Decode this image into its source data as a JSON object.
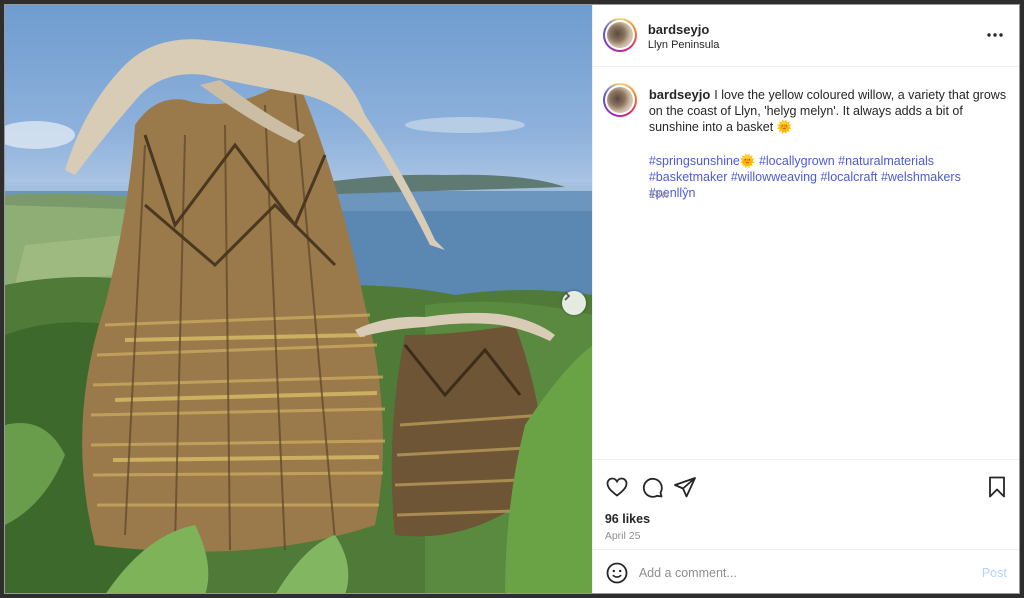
{
  "post": {
    "username": "bardseyjo",
    "location": "Llyn Peninsula",
    "caption": "I love the yellow coloured willow, a variety that grows on the coast of Llyn, 'helyg melyn'. It always adds a bit of sunshine into a basket",
    "caption_emoji": "🌞",
    "hashtags": [
      "#springsunshine",
      "🌞",
      "#locallygrown",
      "#naturalmaterials",
      "#basketmaker",
      "#willowweaving",
      "#localcraft",
      "#welshmakers",
      "#penllŷn"
    ],
    "time_ago": "18w",
    "likes": "96 likes",
    "date": "April 25"
  },
  "icons": {
    "more": "more-options-icon",
    "like": "heart-icon",
    "comment": "comment-icon",
    "share": "share-icon",
    "save": "bookmark-icon",
    "emoji": "emoji-icon",
    "next": "chevron-right-icon"
  },
  "comment_box": {
    "placeholder": "Add a comment...",
    "post_label": "Post"
  },
  "colors": {
    "hashtag": "#4d5bd6",
    "post_button_disabled": "#b3d4fc",
    "text": "#262626",
    "muted": "#8e8e8e"
  }
}
